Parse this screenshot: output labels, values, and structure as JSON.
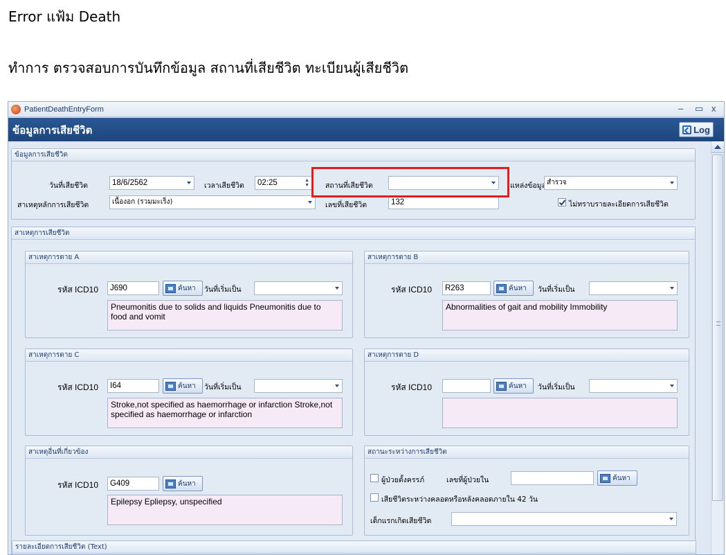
{
  "doc": {
    "title": "Error แฟ้ม Death",
    "description": "ทำการ ตรวจสอบการบันทึกข้อมูล สถานที่เสียชีวิต   ทะเบียนผู้เสียชีวิต"
  },
  "window": {
    "title": "PatientDeathEntryForm",
    "minimize": "–",
    "maximize": "▭",
    "close": "x",
    "header": "ข้อมูลการเสียชีวิต",
    "log_label": "Log"
  },
  "death_info": {
    "section_title": "ข้อมูลการเสียชีวิต",
    "death_date_label": "วันที่เสียชีวิต",
    "death_date": "18/6/2562",
    "death_time_label": "เวลาเสียชีวิต",
    "death_time": "02:25",
    "death_place_label": "สถานที่เสียชีวิต",
    "death_place": "",
    "source_label": "แหล่งข้อมูล",
    "source": "สำรวจ",
    "main_cause_label": "สาเหตุหลักการเสียชีวิต",
    "main_cause": "เนื้องอก (รวมมะเร็ง)",
    "death_no_label": "เลขที่เสียชีวิต",
    "death_no": "132",
    "unknown_detail_label": "ไม่ทราบรายละเอียดการเสียชีวิต",
    "unknown_detail_checked": true
  },
  "causes": {
    "section_title": "สาเหตุการเสียชีวิต",
    "icd_label": "รหัส ICD10",
    "search_label": "ค้นหา",
    "onset_label": "วันที่เริ่มเป็น",
    "a": {
      "title": "สาเหตุการตาย A",
      "code": "J690",
      "onset": "",
      "desc": "Pneumonitis due to solids and liquids Pneumonitis due to food and vomit"
    },
    "b": {
      "title": "สาเหตุการตาย B",
      "code": "R263",
      "onset": "",
      "desc": "Abnormalities of gait and mobility Immobility"
    },
    "c": {
      "title": "สาเหตุการตาย C",
      "code": "I64",
      "onset": "",
      "desc": "Stroke,not specified as haemorrhage or infarction Stroke,not specified as haemorrhage or infarction"
    },
    "d": {
      "title": "สาเหตุการตาย D",
      "code": "",
      "onset": "",
      "desc": ""
    },
    "other": {
      "title": "สาเหตุอื่นที่เกี่ยวข้อง",
      "code": "G409",
      "desc": "Epilepsy Epliepsy, unspecified"
    }
  },
  "status": {
    "title": "สถานะระหว่างการเสียชีวิต",
    "pregnant_label": "ผู้ป่วยตั้งครรภ์",
    "pregnant_checked": false,
    "admit_no_label": "เลขที่ผู้ป่วยใน",
    "admit_no": "",
    "search_label": "ค้นหา",
    "postpartum_label": "เสียชีวิตระหว่างคลอดหรือหลังคลอดภายใน 42 วัน",
    "postpartum_checked": false,
    "infant_label": "เด็กแรกเกิดเสียชีวิต",
    "infant": ""
  },
  "detail": {
    "title": "รายละเอียดการเสียชีวิต (Text)"
  },
  "colors": {
    "header_bg": "#1c467d",
    "highlight": "#e31b1b",
    "memo_bg": "#f5eaf5",
    "panel_bg": "#e2eaf4"
  }
}
